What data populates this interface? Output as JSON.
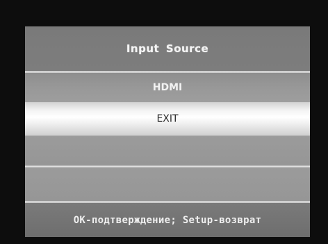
{
  "osd": {
    "title": "Input Source",
    "items": [
      {
        "label": "HDMI",
        "selected": false
      },
      {
        "label": "EXIT",
        "selected": true
      }
    ],
    "footer_hint": "OK-подтверждение; Setup-возврат"
  },
  "colors": {
    "background": "#0d0d0d",
    "panel": "#8a8a8a",
    "highlight": "#ffffff",
    "text_light": "#f4f4f4",
    "text_dark": "#2a2a2a"
  }
}
